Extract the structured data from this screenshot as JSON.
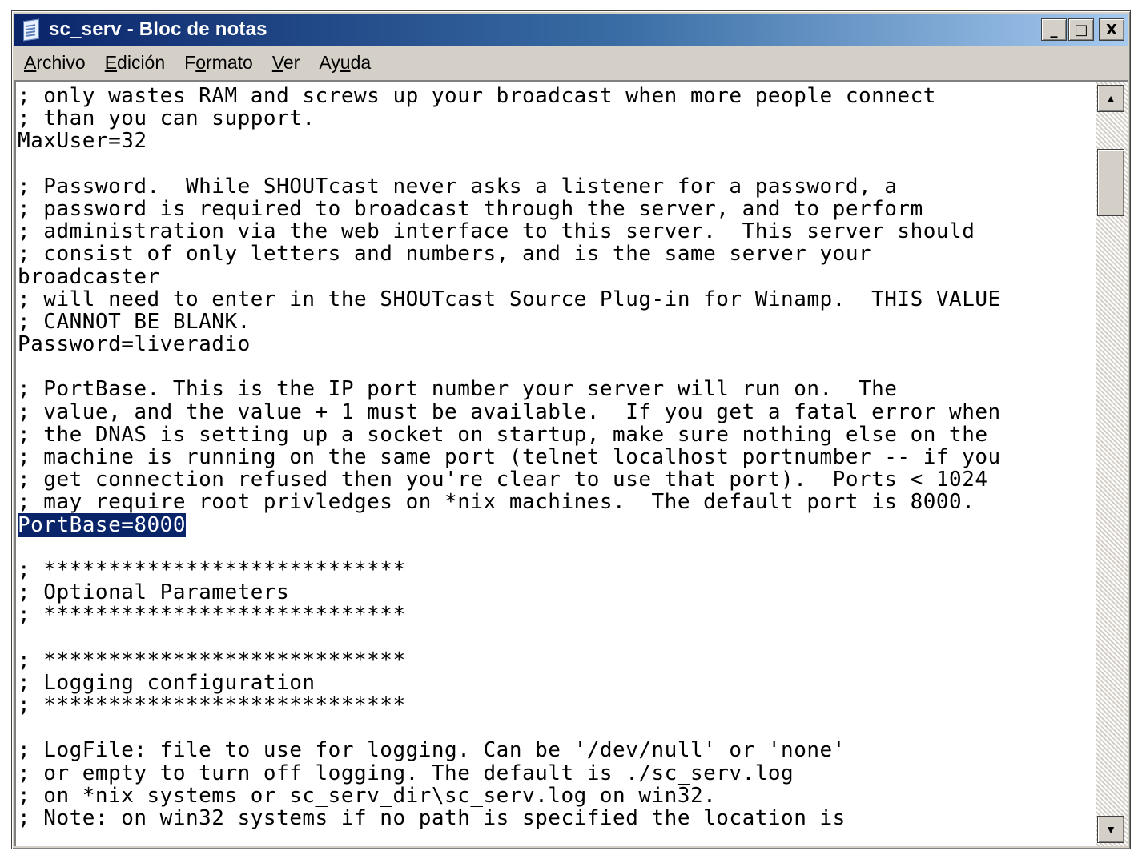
{
  "window": {
    "title": "sc_serv - Bloc de notas",
    "icon": "notepad-icon",
    "buttons": {
      "minimize": "_",
      "maximize": "□",
      "close": "X"
    }
  },
  "menu": {
    "archivo": {
      "mnemonic": "A",
      "rest": "rchivo"
    },
    "edicion": {
      "mnemonic": "E",
      "rest": "dición"
    },
    "formato_pre": "F",
    "formato_mnemonic": "o",
    "formato_rest": "rmato",
    "ver": {
      "mnemonic": "V",
      "rest": "er"
    },
    "ayuda_pre": "Ay",
    "ayuda_mnemonic": "u",
    "ayuda_rest": "da"
  },
  "document": {
    "lines": [
      "; only wastes RAM and screws up your broadcast when more people connect",
      "; than you can support.",
      "MaxUser=32",
      "",
      "; Password.  While SHOUTcast never asks a listener for a password, a",
      "; password is required to broadcast through the server, and to perform",
      "; administration via the web interface to this server.  This server should",
      "; consist of only letters and numbers, and is the same server your",
      "broadcaster",
      "; will need to enter in the SHOUTcast Source Plug-in for Winamp.  THIS VALUE",
      "; CANNOT BE BLANK.",
      "Password=liveradio",
      "",
      "; PortBase. This is the IP port number your server will run on.  The",
      "; value, and the value + 1 must be available.  If you get a fatal error when",
      "; the DNAS is setting up a socket on startup, make sure nothing else on the",
      "; machine is running on the same port (telnet localhost portnumber -- if you",
      "; get connection refused then you're clear to use that port).  Ports < 1024",
      "; may require root privledges on *nix machines.  The default port is 8000."
    ],
    "selected_line": "PortBase=8000",
    "lines_after": [
      "",
      "; ****************************",
      "; Optional Parameters",
      "; ****************************",
      "",
      "; ****************************",
      "; Logging configuration",
      "; ****************************",
      "",
      "; LogFile: file to use for logging. Can be '/dev/null' or 'none'",
      "; or empty to turn off logging. The default is ./sc_serv.log",
      "; on *nix systems or sc_serv_dir\\sc_serv.log on win32.",
      "; Note: on win32 systems if no path is specified the location is"
    ]
  },
  "scrollbar": {
    "up_arrow": "▲",
    "down_arrow": "▼"
  },
  "colors": {
    "titlebar_start": "#0a246a",
    "titlebar_end": "#a6caf0",
    "selection": "#0a246a",
    "chrome": "#d4d0c8"
  }
}
